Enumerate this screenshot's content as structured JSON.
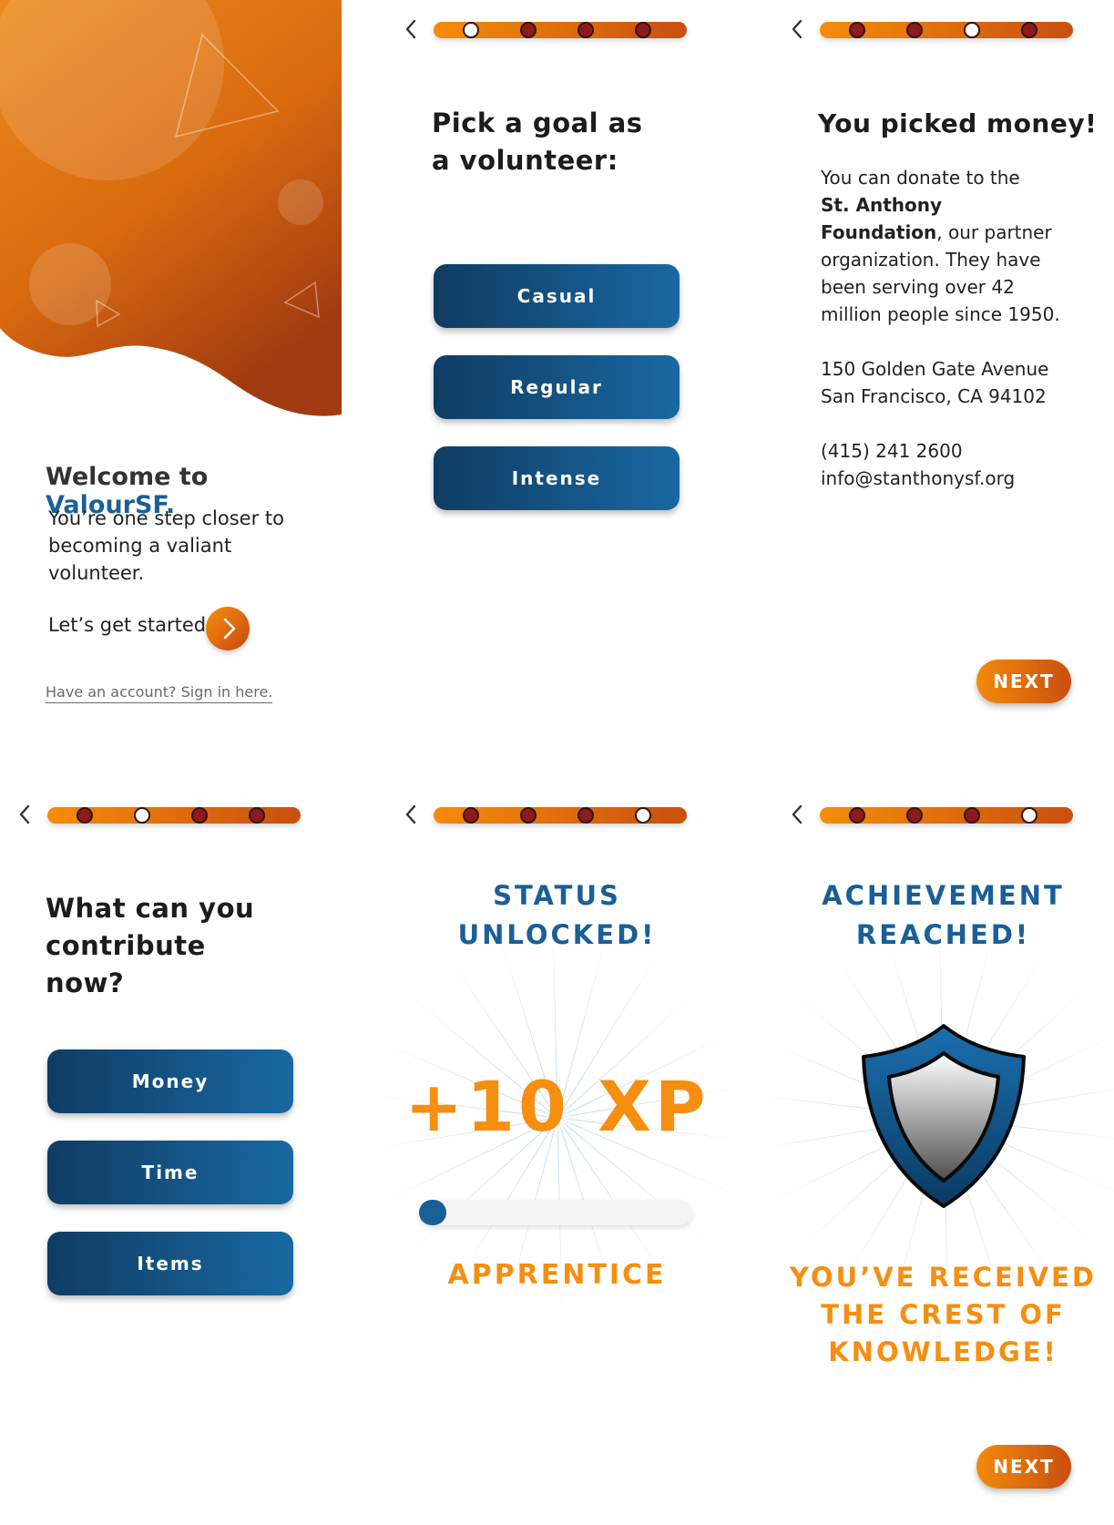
{
  "welcome": {
    "title_prefix": "Welcome to ",
    "title_brand": "ValourSF.",
    "subtitle": "You’re one step closer to becoming a valiant volunteer.",
    "cta_text": "Let’s get started.",
    "sign_in_link": "Have an account? Sign in here."
  },
  "goal": {
    "heading": "Pick a goal as a volunteer:",
    "options": [
      "Casual",
      "Regular",
      "Intense"
    ]
  },
  "contribute": {
    "heading": "What can you contribute now?",
    "options": [
      "Money",
      "Time",
      "Items"
    ]
  },
  "money": {
    "heading": "You picked money!",
    "intro": "You can donate to the",
    "org_name": "St. Anthony Foundation",
    "org_punct": ",",
    "description": "our partner organization. They have been serving over 42 million people since 1950.",
    "address_line1": "150 Golden Gate Avenue",
    "address_line2": "San Francisco, CA 94102",
    "phone": "(415) 241 2600",
    "email": "info@stanthonysf.org",
    "next_label": "NEXT"
  },
  "status": {
    "title_line1": "STATUS",
    "title_line2": "UNLOCKED!",
    "xp": "+10 XP",
    "rank": "APPRENTICE",
    "progress_fraction": 0.1
  },
  "achievement": {
    "title_line1": "ACHIEVEMENT",
    "title_line2": "REACHED!",
    "message_line1": "YOU’VE RECEIVED",
    "message_line2": "THE CREST OF",
    "message_line3": "KNOWLEDGE!",
    "next_label": "NEXT"
  },
  "progress_steps": {
    "goal": 1,
    "money": 3,
    "contribute": 2,
    "status": 4,
    "achievement": 4
  },
  "colors": {
    "brand_blue": "#1a5f97",
    "accent_orange": "#f68e10",
    "dot_inactive": "#8e1a1a"
  },
  "icons": {
    "back": "chevron-left-icon",
    "cta": "chevron-right-icon",
    "crest": "shield-icon"
  }
}
